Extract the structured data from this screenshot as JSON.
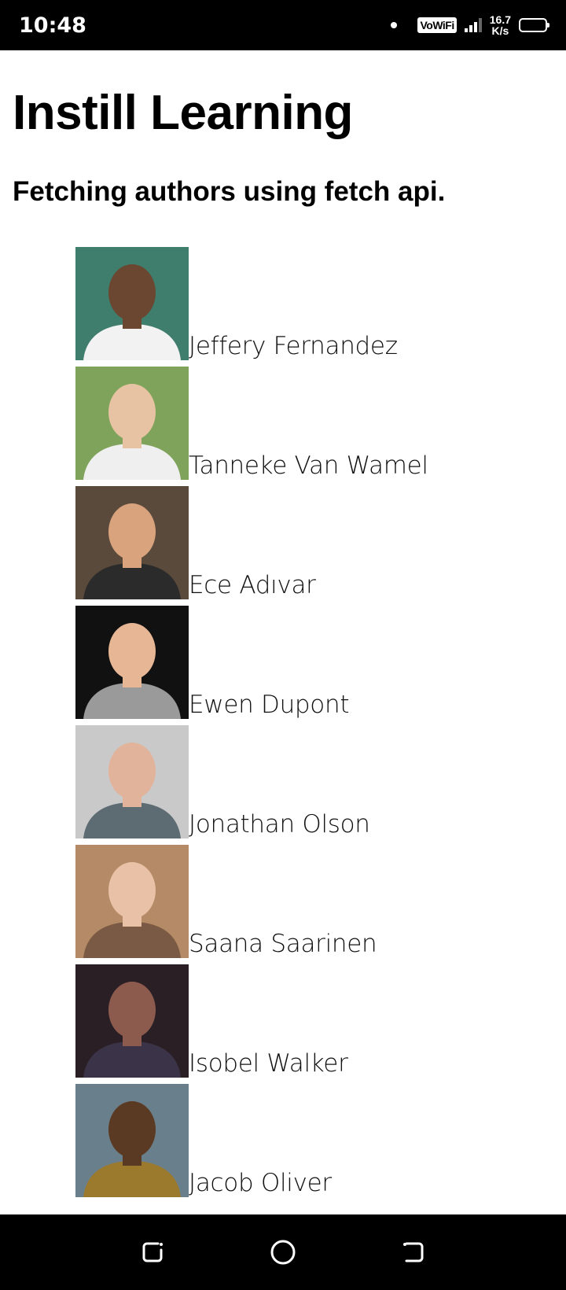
{
  "status_bar": {
    "time": "10:48",
    "network_label": "VoWiFi",
    "speed_value": "16.7",
    "speed_unit": "K/s"
  },
  "page": {
    "title": "Instill Learning",
    "subtitle": "Fetching authors using fetch api."
  },
  "authors": [
    {
      "name": "Jeffery Fernandez",
      "avatar_bg": "#3f7d6d",
      "skin": "#6b4630",
      "shirt": "#f2f2f2"
    },
    {
      "name": "Tanneke Van Wamel",
      "avatar_bg": "#7fa35a",
      "skin": "#e7c3a3",
      "shirt": "#efefef"
    },
    {
      "name": "Ece Adıvar",
      "avatar_bg": "#5a4a3c",
      "skin": "#d9a37e",
      "shirt": "#2b2b2b"
    },
    {
      "name": "Ewen Dupont",
      "avatar_bg": "#111111",
      "skin": "#e6b695",
      "shirt": "#9a9a9a"
    },
    {
      "name": "Jonathan Olson",
      "avatar_bg": "#c9c9c9",
      "skin": "#e2b39b",
      "shirt": "#5d6b73"
    },
    {
      "name": "Saana Saarinen",
      "avatar_bg": "#b58a66",
      "skin": "#e8c1a6",
      "shirt": "#7a5a44"
    },
    {
      "name": "Isobel Walker",
      "avatar_bg": "#2a1f24",
      "skin": "#8d5b4e",
      "shirt": "#3b3347"
    },
    {
      "name": "Jacob Oliver",
      "avatar_bg": "#6a7f8c",
      "skin": "#5a3a22",
      "shirt": "#9b7a2e"
    }
  ]
}
